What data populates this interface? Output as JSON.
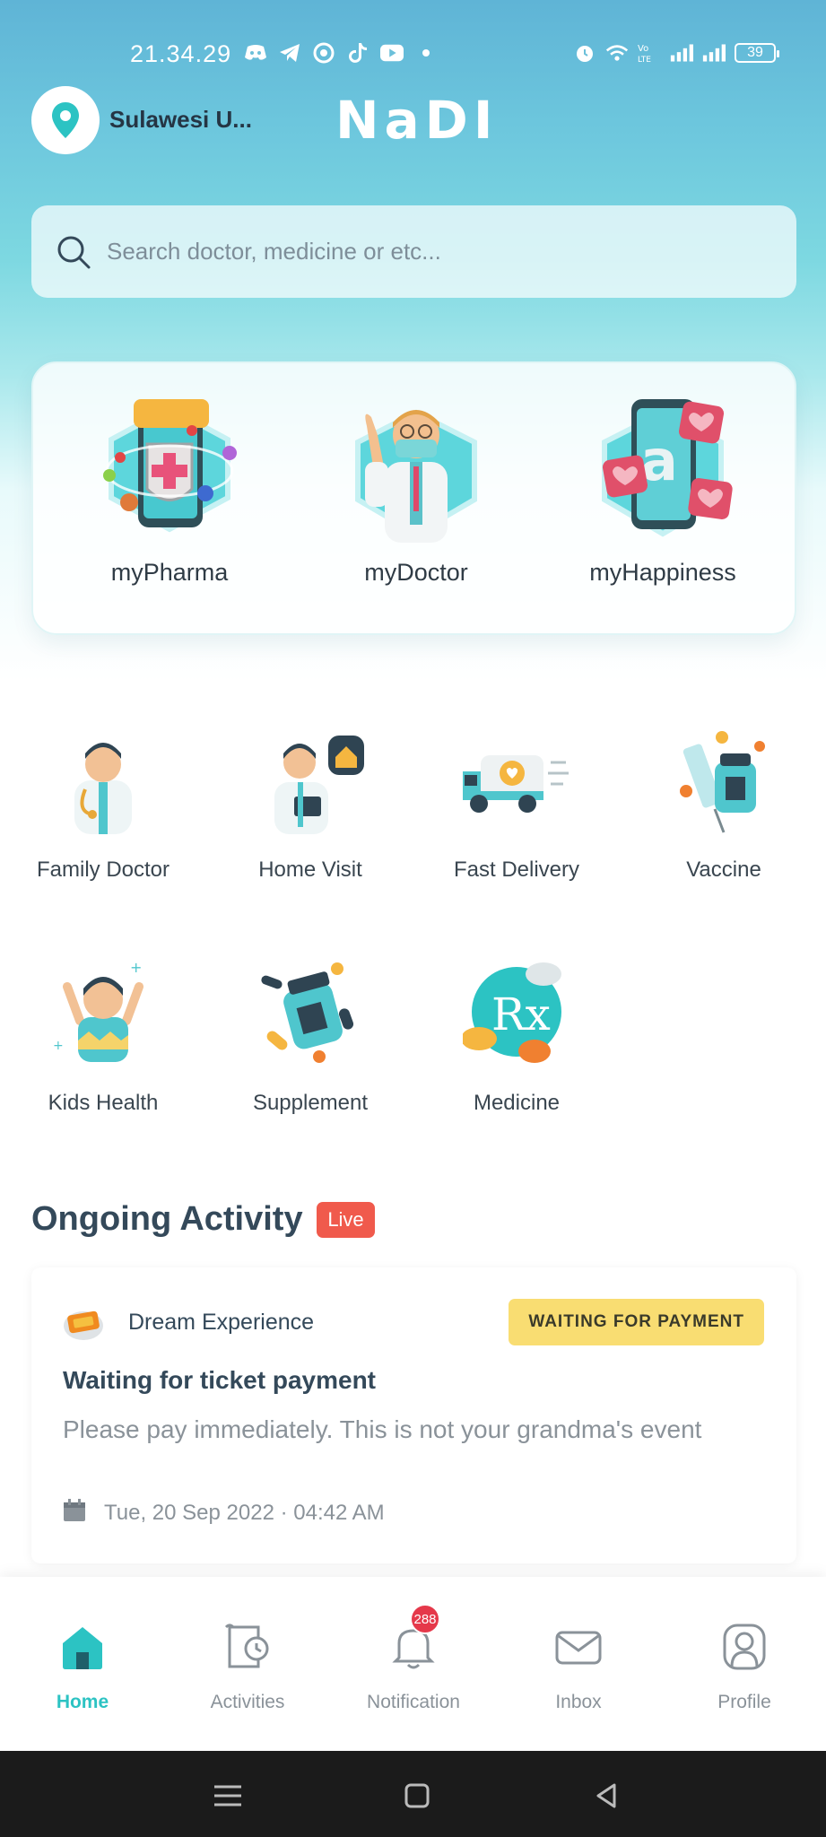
{
  "status_bar": {
    "time": "21.34.29",
    "left_icons": [
      "discord-icon",
      "telegram-icon",
      "circle-app-icon",
      "tiktok-icon",
      "youtube-icon",
      "dot-icon"
    ],
    "right_icons": [
      "alarm-icon",
      "wifi-icon",
      "volte-icon",
      "signal-icon",
      "signal-icon"
    ],
    "battery": "39"
  },
  "header": {
    "location": "Sulawesi U...",
    "brand": "NaDI"
  },
  "search": {
    "placeholder": "Search doctor, medicine or etc..."
  },
  "features": [
    {
      "label": "myPharma"
    },
    {
      "label": "myDoctor"
    },
    {
      "label": "myHappiness"
    }
  ],
  "services": [
    {
      "label": "Family Doctor"
    },
    {
      "label": "Home Visit"
    },
    {
      "label": "Fast Delivery"
    },
    {
      "label": "Vaccine"
    },
    {
      "label": "Kids Health"
    },
    {
      "label": "Supplement"
    },
    {
      "label": "Medicine"
    }
  ],
  "ongoing": {
    "title": "Ongoing Activity",
    "badge": "Live",
    "card": {
      "source": "Dream Experience",
      "status": "WAITING FOR PAYMENT",
      "title": "Waiting for ticket payment",
      "description": "Please pay immediately. This is not your grandma's event",
      "date": "Tue, 20 Sep 2022 · 04:42 AM"
    }
  },
  "bottom_nav": [
    {
      "label": "Home",
      "icon": "home-icon",
      "active": true
    },
    {
      "label": "Activities",
      "icon": "receipt-clock-icon"
    },
    {
      "label": "Notification",
      "icon": "bell-icon",
      "badge": "288"
    },
    {
      "label": "Inbox",
      "icon": "mail-icon"
    },
    {
      "label": "Profile",
      "icon": "profile-icon"
    }
  ],
  "colors": {
    "accent": "#2cc3c3",
    "live": "#f05a4c",
    "status_chip": "#f9dd72",
    "badge": "#e5384a"
  }
}
